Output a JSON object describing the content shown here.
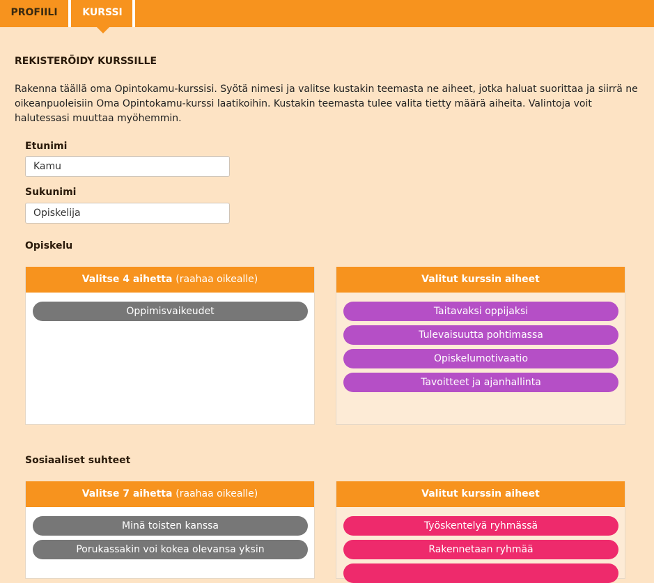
{
  "tabs": [
    {
      "label": "PROFIILI"
    },
    {
      "label": "KURSSI"
    }
  ],
  "page_title": "REKISTERÖIDY KURSSILLE",
  "intro": "Rakenna täällä oma Opintokamu-kurssisi. Syötä nimesi ja valitse kustakin teemasta ne aiheet, jotka haluat suorittaa ja siirrä ne oikeanpuoleisiin Oma Opintokamu-kurssi laatikoihin. Kustakin teemasta tulee valita tietty määrä aiheita. Valintoja voit halutessasi muuttaa myöhemmin.",
  "form": {
    "first_name_label": "Etunimi",
    "first_name_value": "Kamu",
    "last_name_label": "Sukunimi",
    "last_name_value": "Opiskelija"
  },
  "sections": [
    {
      "title": "Opiskelu",
      "left_heading": "Valitse 4 aihetta",
      "left_hint": "(raahaa oikealle)",
      "right_heading": "Valitut kurssin aiheet",
      "available": [
        "Oppimisvaikeudet"
      ],
      "selected": [
        "Taitavaksi oppijaksi",
        "Tulevaisuutta pohtimassa",
        "Opiskelumotivaatio",
        "Tavoitteet ja ajanhallinta"
      ],
      "selected_color": "#b54fc6"
    },
    {
      "title": "Sosiaaliset suhteet",
      "left_heading": "Valitse 7 aihetta",
      "left_hint": "(raahaa oikealle)",
      "right_heading": "Valitut kurssin aiheet",
      "available": [
        "Minä toisten kanssa",
        "Porukassakin voi kokea olevansa yksin"
      ],
      "selected": [
        "Työskentelyä ryhmässä",
        "Rakennetaan ryhmää",
        ""
      ],
      "selected_color": "#ee2a6c"
    }
  ],
  "colors": {
    "accent": "#f7931e",
    "background": "#fde3c4",
    "pill_gray": "#777777"
  }
}
